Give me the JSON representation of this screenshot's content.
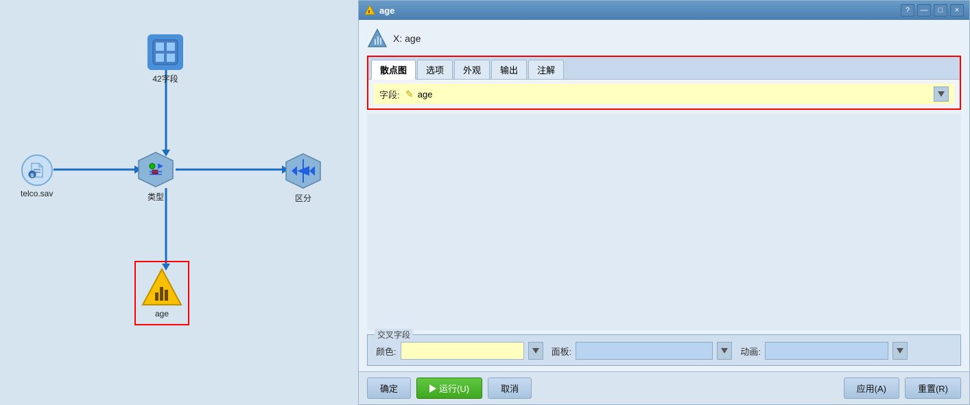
{
  "dialog": {
    "title": "age",
    "close_label": "×",
    "help_label": "?",
    "minimize_label": "—",
    "maximize_label": "□",
    "x_axis_label": "X: age"
  },
  "tabs": {
    "active": "散点图",
    "items": [
      "散点图",
      "选项",
      "外观",
      "输出",
      "注解"
    ]
  },
  "field_row": {
    "label": "字段:",
    "value": "age",
    "pencil": "✎"
  },
  "cross_section": {
    "title": "交叉字段",
    "color_label": "颜色:",
    "panel_label": "面板:",
    "animation_label": "动画:"
  },
  "footer": {
    "confirm_label": "确定",
    "run_label": "运行(U)",
    "cancel_label": "取消",
    "apply_label": "应用(A)",
    "reset_label": "重置(R)"
  },
  "canvas": {
    "node_42_label": "42字段",
    "node_telco_label": "telco.sav",
    "node_type_label": "类型",
    "node_zone_label": "区分",
    "node_age_label": "age"
  }
}
